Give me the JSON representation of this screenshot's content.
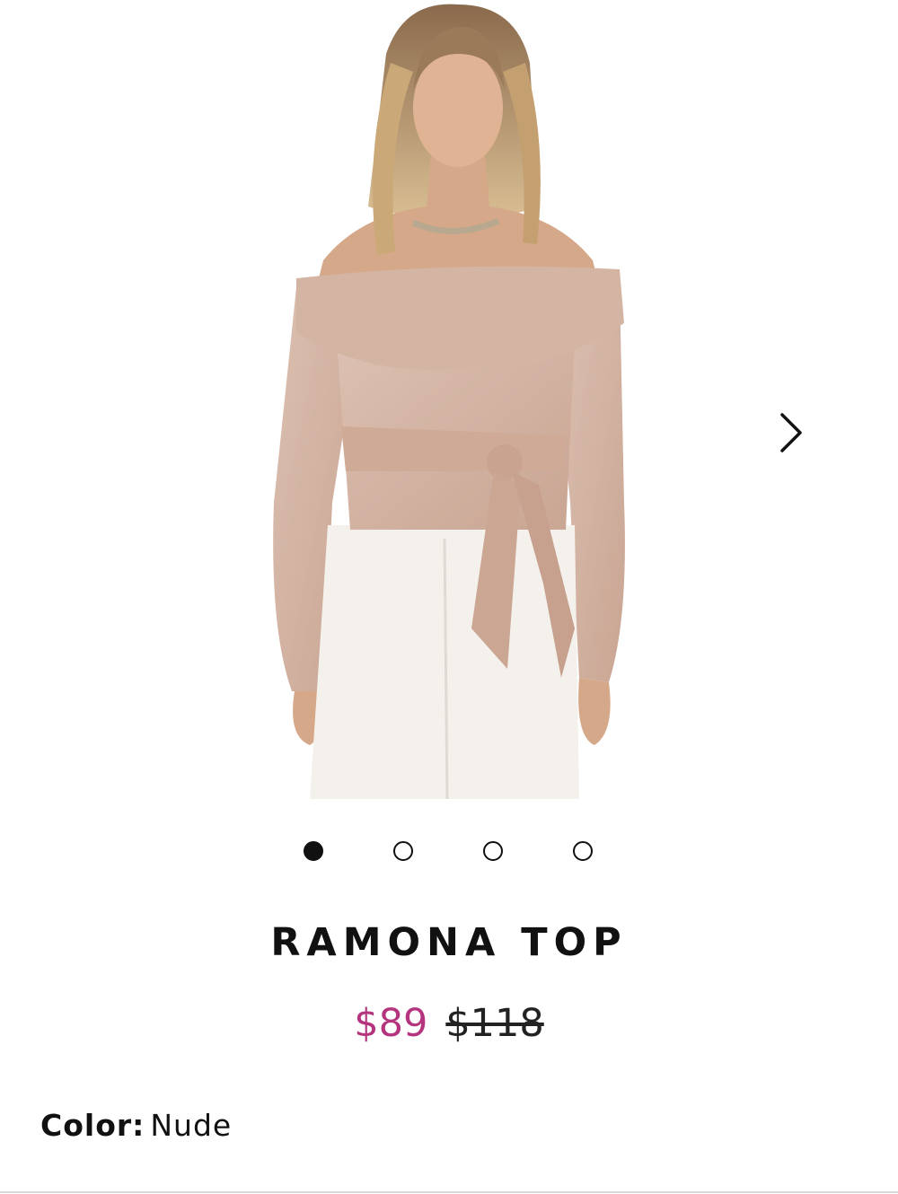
{
  "gallery": {
    "image_alt": "Model wearing nude off-shoulder ribbed top with wrap tie and white trousers",
    "next_icon": "chevron-right-icon",
    "dots": [
      {
        "active": true
      },
      {
        "active": false
      },
      {
        "active": false
      },
      {
        "active": false
      }
    ]
  },
  "product": {
    "title": "RAMONA TOP",
    "sale_price": "$89",
    "original_price": "$118",
    "color_label": "Color:",
    "color_value": "Nude"
  },
  "colors": {
    "sale": "#b4347e",
    "text": "#111111",
    "top_fabric": "#d9b8a8"
  }
}
